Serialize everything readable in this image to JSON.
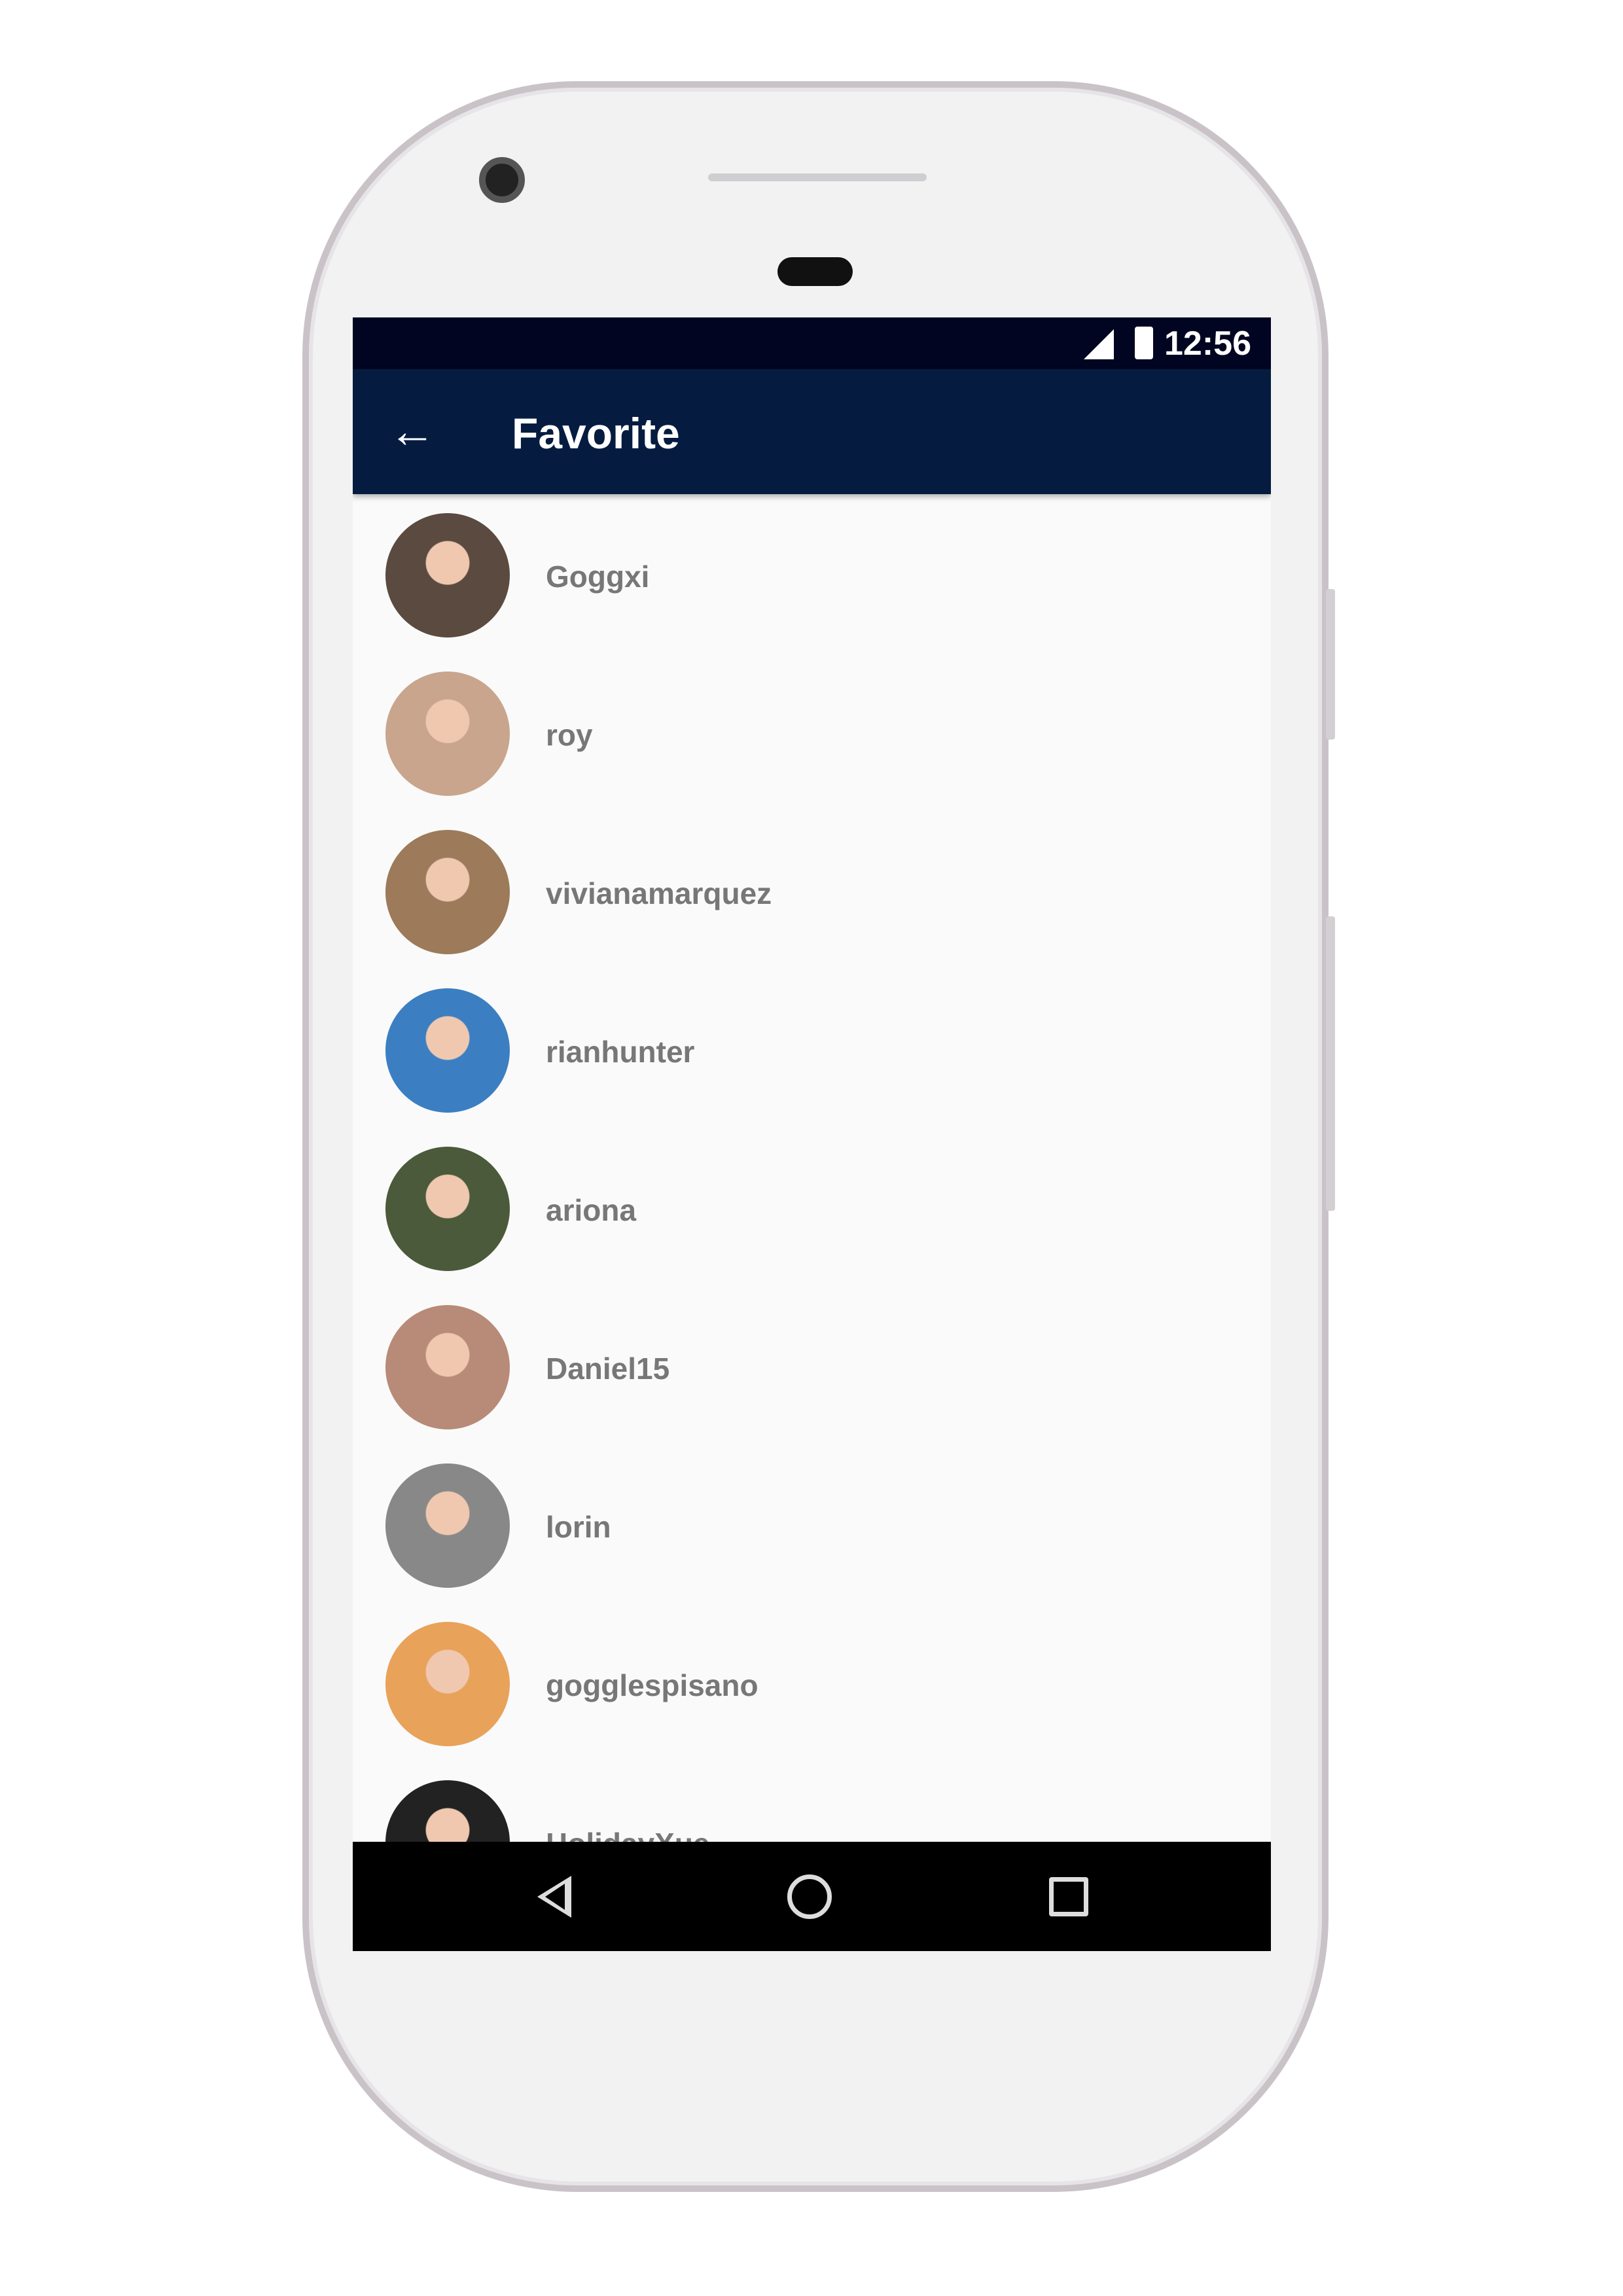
{
  "status_bar": {
    "time": "12:56",
    "icons": [
      "signal-icon",
      "battery-icon"
    ]
  },
  "app_bar": {
    "title": "Favorite",
    "back_icon": "arrow-left-icon"
  },
  "favorites": [
    {
      "name": "Goggxi",
      "avatar_color": "#5a4a40"
    },
    {
      "name": "roy",
      "avatar_color": "#c9a58e"
    },
    {
      "name": "vivianamarquez",
      "avatar_color": "#9c7a5a"
    },
    {
      "name": "rianhunter",
      "avatar_color": "#3b7fc2"
    },
    {
      "name": "ariona",
      "avatar_color": "#4a5a3a"
    },
    {
      "name": "Daniel15",
      "avatar_color": "#b88a78"
    },
    {
      "name": "lorin",
      "avatar_color": "#888888"
    },
    {
      "name": "gogglespisano",
      "avatar_color": "#e8a25a"
    },
    {
      "name": "HolidayXue",
      "avatar_color": "#222222"
    }
  ],
  "nav_bar": {
    "icons": [
      "back-triangle-icon",
      "home-circle-icon",
      "recents-square-icon"
    ]
  }
}
